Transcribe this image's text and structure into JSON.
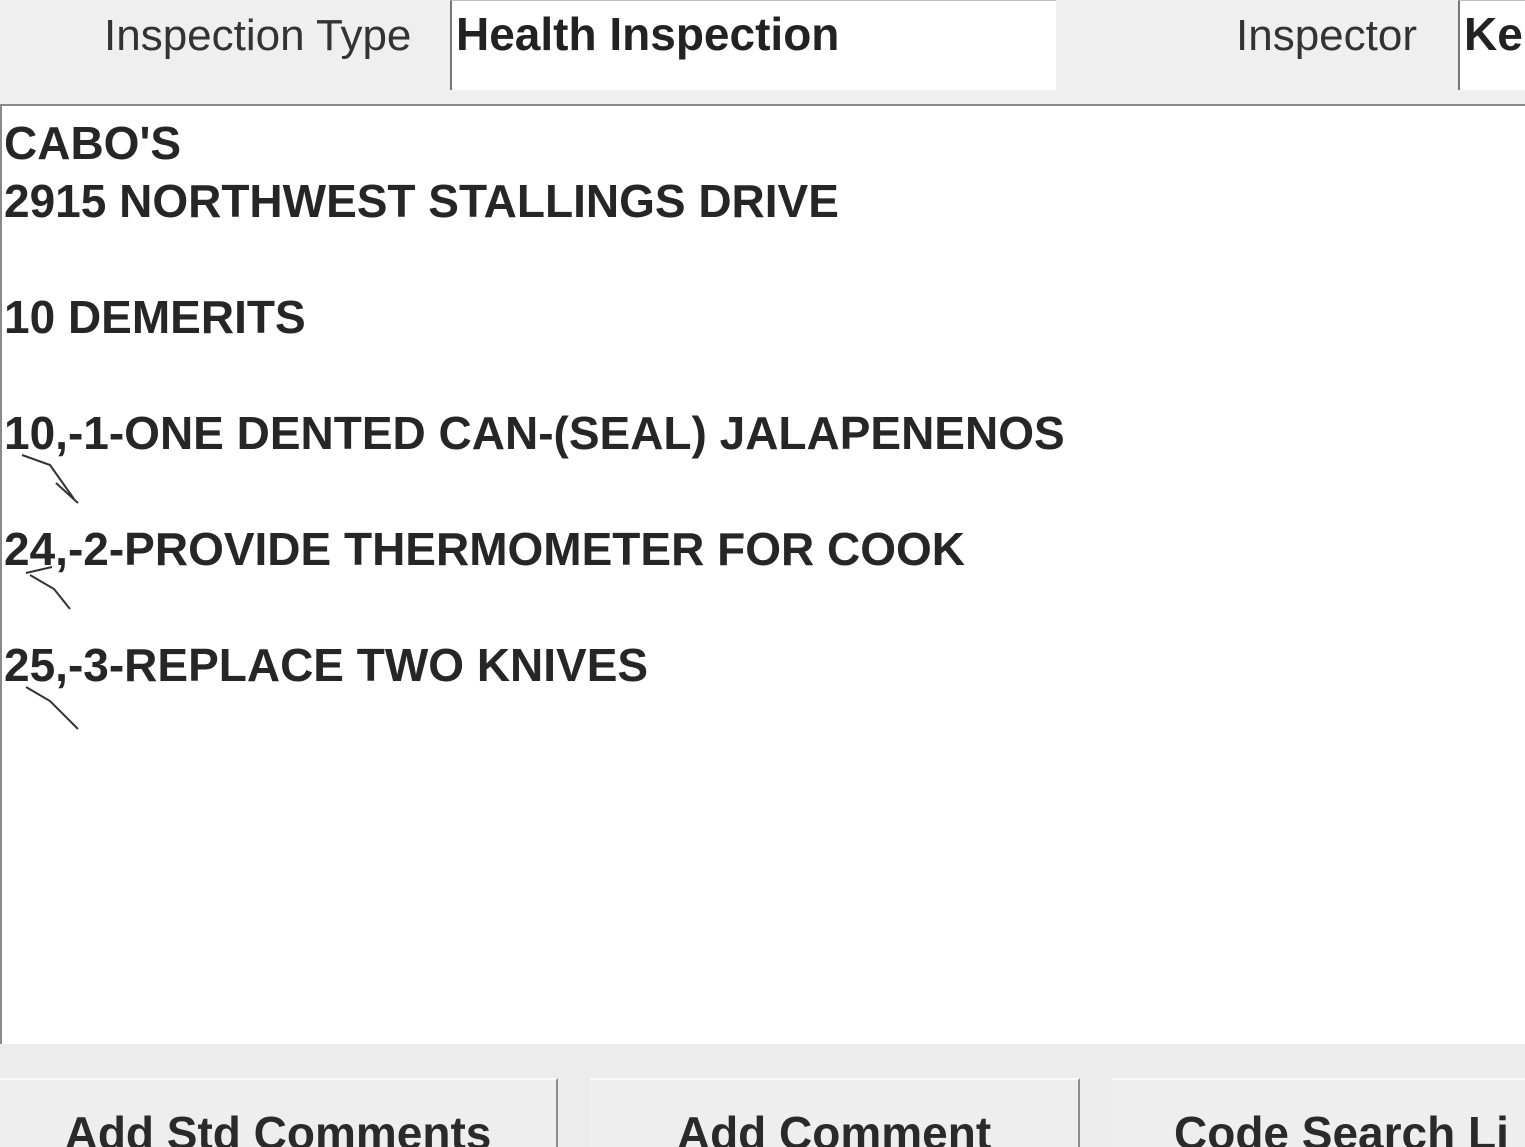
{
  "header": {
    "inspection_type_label": "Inspection Type",
    "inspection_type_value": "Health Inspection",
    "inspector_label": "Inspector",
    "inspector_value": "Ke"
  },
  "comments": {
    "lines": [
      "CABO'S",
      "2915 NORTHWEST STALLINGS DRIVE",
      "",
      "10 DEMERITS",
      "",
      "10,-1-ONE DENTED CAN-(SEAL) JALAPENENOS",
      "",
      "24,-2-PROVIDE THERMOMETER FOR COOK",
      "",
      "25,-3-REPLACE TWO KNIVES"
    ]
  },
  "buttons": {
    "add_std_comments": {
      "pre": "Add ",
      "mnemonic": "S",
      "post": "td Comments"
    },
    "add_comment": {
      "pre": "",
      "mnemonic": "A",
      "post": "dd Comment"
    },
    "code_search": {
      "label": "Code Search Li"
    }
  }
}
